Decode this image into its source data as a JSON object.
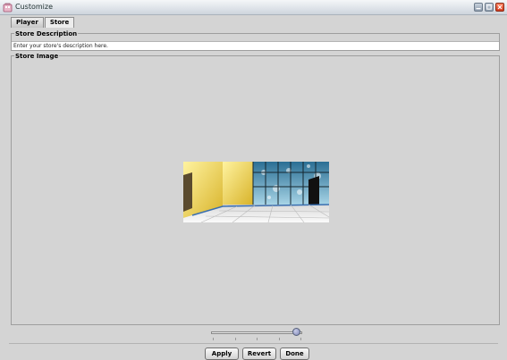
{
  "window": {
    "title": "Customize"
  },
  "tabs": [
    {
      "label": "Player",
      "active": false
    },
    {
      "label": "Store",
      "active": true
    }
  ],
  "store_description": {
    "legend": "Store Description",
    "value": "Enter your store's description here."
  },
  "store_image": {
    "legend": "Store Image"
  },
  "slider": {
    "value_fraction": 0.98,
    "tick_count": 5
  },
  "buttons": {
    "apply": "Apply",
    "revert": "Revert",
    "done": "Done"
  },
  "colors": {
    "window_bg": "#d4d4d4",
    "close_button": "#d23a1c",
    "thumb": "#7e86b6"
  }
}
